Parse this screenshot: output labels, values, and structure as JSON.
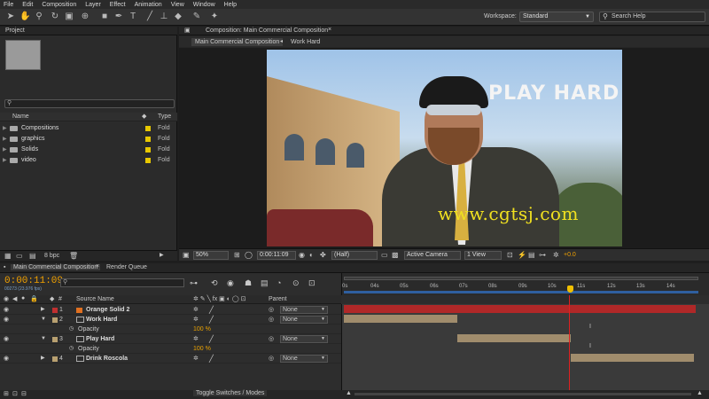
{
  "menu": [
    "File",
    "Edit",
    "Composition",
    "Layer",
    "Effect",
    "Animation",
    "View",
    "Window",
    "Help"
  ],
  "workspace": {
    "label": "Workspace:",
    "value": "Standard"
  },
  "search_help": {
    "placeholder": "Search Help"
  },
  "project": {
    "tab": "Project",
    "columns": {
      "name": "Name",
      "type": "Type"
    },
    "items": [
      {
        "name": "Compositions",
        "type": "Fold"
      },
      {
        "name": "graphics",
        "type": "Fold"
      },
      {
        "name": "Solids",
        "type": "Fold"
      },
      {
        "name": "video",
        "type": "Fold"
      }
    ],
    "bpc": "8 bpc"
  },
  "composition": {
    "tab": "Composition: Main Commercial Composition",
    "breadcrumbs": [
      "Main Commercial Composition",
      "Work Hard"
    ],
    "overlay_text": "PLAY HARD",
    "watermark": "www.cgtsj.com",
    "zoom": "50%",
    "timecode": "0:00:11:09",
    "resolution": "(Half)",
    "camera": "Active Camera",
    "view": "1 View",
    "exposure": "+0.0"
  },
  "timeline": {
    "tab": "Main Commercial Composition",
    "render_tab": "Render Queue",
    "timecode": "0:00:11:09",
    "fps": "00273 (23.976 fps)",
    "columns": {
      "source": "Source Name",
      "parent": "Parent"
    },
    "ticks": [
      "0s",
      "04s",
      "05s",
      "06s",
      "07s",
      "08s",
      "09s",
      "10s",
      "11s",
      "12s",
      "13s",
      "14s"
    ],
    "layers": [
      {
        "num": "1",
        "name": "Orange Solid 2",
        "color": "#e07020",
        "parent": "None"
      },
      {
        "num": "2",
        "name": "Work Hard",
        "color": "#c8a060",
        "parent": "None",
        "prop": "Opacity",
        "value": "100 %"
      },
      {
        "num": "3",
        "name": "Play Hard",
        "color": "#c8a060",
        "parent": "None",
        "prop": "Opacity",
        "value": "100 %"
      },
      {
        "num": "4",
        "name": "Drink Roscola",
        "color": "#c8a060",
        "parent": "None"
      }
    ],
    "toggle": "Toggle Switches / Modes"
  },
  "colors": {
    "accent": "#f0a000",
    "cti": "#e02020",
    "solid_bar": "#b02828",
    "footage_bar": "#a08c6c"
  }
}
